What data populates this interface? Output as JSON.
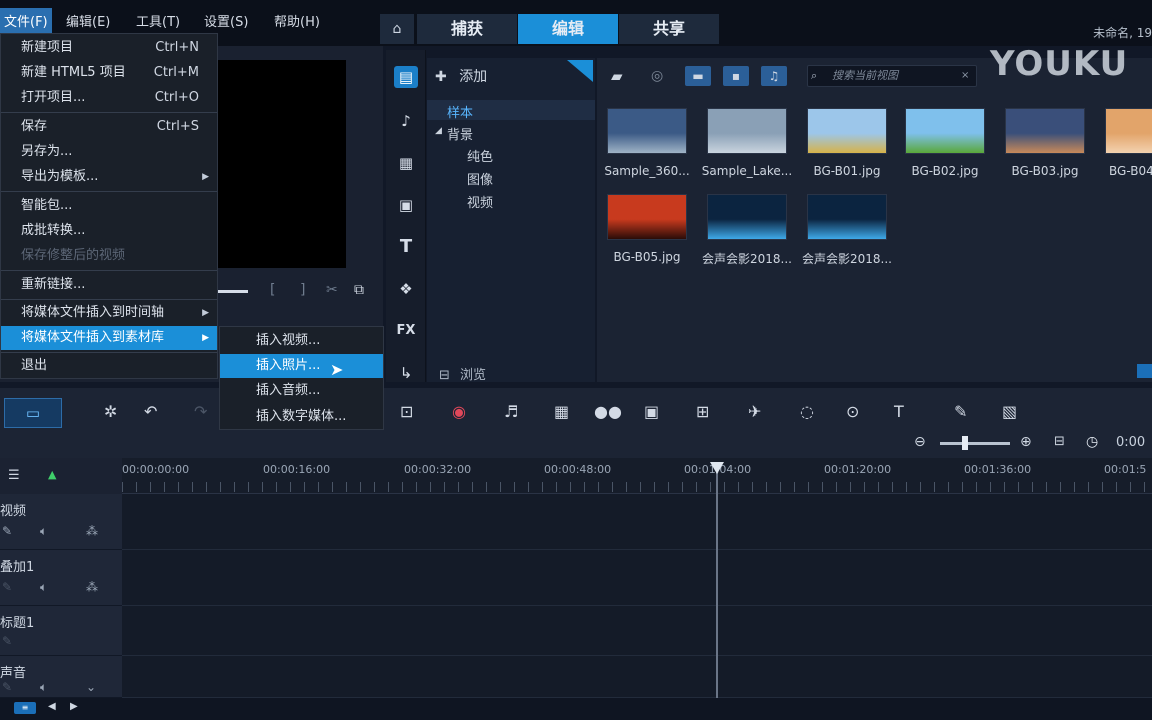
{
  "menubar": {
    "file": "文件(F)",
    "edit": "编辑(E)",
    "tools": "工具(T)",
    "settings": "设置(S)",
    "help": "帮助(H)"
  },
  "tabs": {
    "home_icon": "⌂",
    "capture": "捕获",
    "edit": "编辑",
    "share": "共享"
  },
  "project_name": "未命名, 19",
  "watermark": "YOUKU",
  "file_menu": {
    "new_project": "新建项目",
    "new_project_sc": "Ctrl+N",
    "new_html5": "新建 HTML5 项目",
    "new_html5_sc": "Ctrl+M",
    "open_project": "打开项目...",
    "open_project_sc": "Ctrl+O",
    "save": "保存",
    "save_sc": "Ctrl+S",
    "save_as": "另存为...",
    "export_template": "导出为模板...",
    "smart_package": "智能包...",
    "batch_convert": "成批转换...",
    "save_trimmed": "保存修整后的视频",
    "relink": "重新链接...",
    "insert_to_timeline": "将媒体文件插入到时间轴",
    "insert_to_library": "将媒体文件插入到素材库",
    "exit": "退出"
  },
  "sub_menu": {
    "insert_video": "插入视频...",
    "insert_photo": "插入照片...",
    "insert_audio": "插入音频...",
    "insert_digital": "插入数字媒体..."
  },
  "library": {
    "add": "添加",
    "tree_samples": "样本",
    "tree_background": "背景",
    "tree_solid": "纯色",
    "tree_image": "图像",
    "tree_video": "视频",
    "browse": "浏览",
    "search_placeholder": "搜索当前视图"
  },
  "media": {
    "items": [
      {
        "label": "Sample_360...",
        "colors": [
          "#3b5a86",
          "#9fb3c6"
        ]
      },
      {
        "label": "Sample_Lake...",
        "colors": [
          "#8aa0b6",
          "#c9d4de"
        ]
      },
      {
        "label": "BG-B01.jpg",
        "colors": [
          "#9cc6ea",
          "#d6b34a"
        ]
      },
      {
        "label": "BG-B02.jpg",
        "colors": [
          "#7fc0ec",
          "#5aa83a"
        ]
      },
      {
        "label": "BG-B03.jpg",
        "colors": [
          "#3a4f7a",
          "#c88a5a"
        ]
      },
      {
        "label": "BG-B04",
        "colors": [
          "#e2a46a",
          "#f3d2b0"
        ]
      },
      {
        "label": "BG-B05.jpg",
        "colors": [
          "#c83a1e",
          "#2a0c08"
        ]
      },
      {
        "label": "会声会影2018...",
        "colors": [
          "#0b2440",
          "#3fa9e8"
        ]
      },
      {
        "label": "会声会影2018...",
        "colors": [
          "#0b2440",
          "#3fa9e8"
        ]
      }
    ]
  },
  "timeline": {
    "ticks": [
      "00:00:00:00",
      "00:00:16:00",
      "00:00:32:00",
      "00:00:48:00",
      "00:01:04:00",
      "00:01:20:00",
      "00:01:36:00",
      "00:01:5"
    ],
    "time_display": "0:00",
    "tracks": [
      "视频",
      "叠加1",
      "标题1",
      "声音"
    ]
  }
}
